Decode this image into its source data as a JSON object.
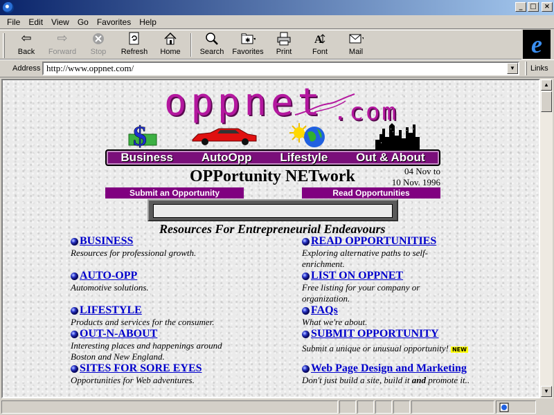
{
  "window": {
    "minimize": "_",
    "maximize": "□",
    "close": "×"
  },
  "menu": [
    "File",
    "Edit",
    "View",
    "Go",
    "Favorites",
    "Help"
  ],
  "toolbar": {
    "back": "Back",
    "forward": "Forward",
    "stop": "Stop",
    "refresh": "Refresh",
    "home": "Home",
    "search": "Search",
    "favorites": "Favorites",
    "print": "Print",
    "font": "Font",
    "mail": "Mail"
  },
  "address": {
    "label": "Address",
    "url": "http://www.oppnet.com/",
    "links": "Links"
  },
  "page": {
    "logo_main": "oppnet",
    "logo_com": ".com",
    "nav": [
      "Business",
      "AutoOpp",
      "Lifestyle",
      "Out & About"
    ],
    "heading": "OPPortunity NETwork",
    "date_line1": "04 Nov to",
    "date_line2": "10 Nov. 1996",
    "submit_btn": "Submit an Opportunity",
    "read_btn": "Read Opportunities",
    "subheading": "Resources For Entrepreneurial Endeavours",
    "left": [
      {
        "title": "BUSINESS",
        "desc": "Resources for professional growth."
      },
      {
        "title": "AUTO-OPP",
        "desc": "Automotive solutions."
      },
      {
        "title": "LIFESTYLE",
        "desc": "Products and services for the consumer."
      },
      {
        "title": "OUT-N-ABOUT",
        "desc": "Interesting places and happenings around Boston and New England."
      },
      {
        "title": "SITES FOR SORE EYES",
        "desc": "Opportunities for Web adventures."
      }
    ],
    "right": [
      {
        "title": "READ OPPORTUNITIES",
        "desc": "Exploring alternative paths to self-enrichment."
      },
      {
        "title": "LIST ON OPPNET",
        "desc": "Free listing for your company or organization."
      },
      {
        "title": "FAQs",
        "desc": "What we're about."
      },
      {
        "title": "SUBMIT OPPORTUNITY",
        "desc": "Submit a unique or unusual opportunity!",
        "badge": "NEW"
      },
      {
        "title": "Web Page Design and Marketing",
        "desc_pre": "Don't just build a site, build it ",
        "desc_bold": "and",
        "desc_post": " promote it.."
      }
    ]
  },
  "colors": {
    "titlebar": "#0a246a",
    "link": "#0000cc",
    "brand": "#b4179f",
    "nav_bg": "#7a0f7a",
    "button_bg": "#800080"
  }
}
